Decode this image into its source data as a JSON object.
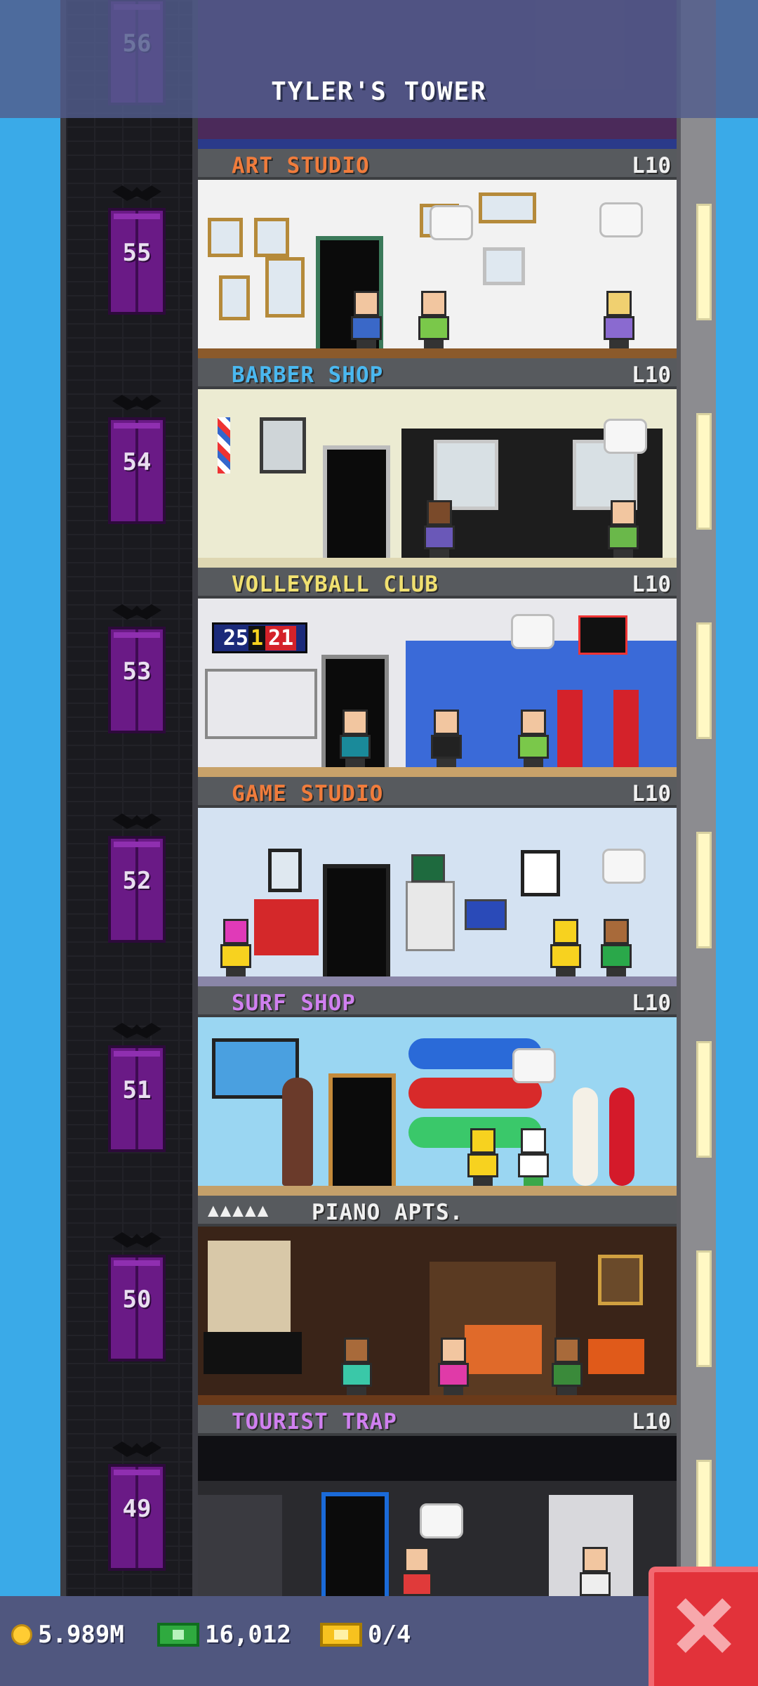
{
  "tower": {
    "title": "TYLER'S TOWER"
  },
  "floors": [
    {
      "number": "56"
    },
    {
      "number": "55",
      "name": "ART STUDIO",
      "level": "L10",
      "color": "#f07c3c"
    },
    {
      "number": "54",
      "name": "BARBER SHOP",
      "level": "L10",
      "color": "#4ab8f0"
    },
    {
      "number": "53",
      "name": "VOLLEYBALL CLUB",
      "level": "L10",
      "color": "#f0e070"
    },
    {
      "number": "52",
      "name": "GAME STUDIO",
      "level": "L10",
      "color": "#f07c3c"
    },
    {
      "number": "51",
      "name": "SURF SHOP",
      "level": "L10",
      "color": "#d080f0"
    },
    {
      "number": "50",
      "name": "PIANO APTS.",
      "stars": "▲▲▲▲▲",
      "color": "#f0f0f0"
    },
    {
      "number": "49",
      "name": "TOURIST TRAP",
      "level": "L10",
      "color": "#d080f0"
    }
  ],
  "scoreboard": {
    "left": "25",
    "mid": "1",
    "right": "21"
  },
  "status": {
    "coins": "5.989M",
    "bux": "16,012",
    "tickets": "0/4"
  },
  "colors": {
    "sky": "#3aaae8",
    "elevator": "#6a1a86",
    "close": "#e2323a"
  },
  "icons": {
    "coin": "coin-icon",
    "bux": "bux-icon",
    "ticket": "ticket-icon",
    "close": "close-icon"
  }
}
